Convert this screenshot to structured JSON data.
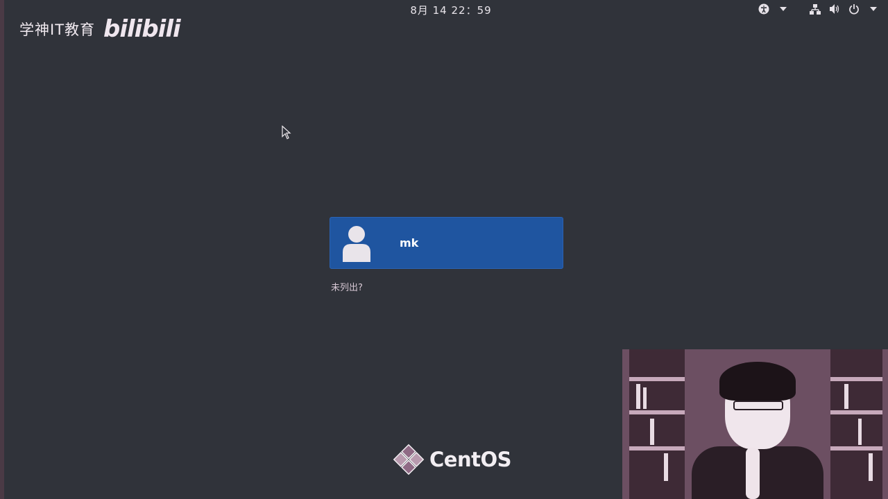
{
  "topbar": {
    "clock": "8月 14  22：59",
    "tray_icons": [
      "accessibility-icon",
      "chevron-down-icon",
      "network-icon",
      "volume-icon",
      "power-icon",
      "chevron-down-icon"
    ]
  },
  "watermark": {
    "brand": "学神IT教育",
    "bilibili": "bilibili"
  },
  "login": {
    "users": [
      {
        "name": "mk",
        "avatar_icon": "user-avatar-icon"
      }
    ],
    "not_listed_label": "未列出?"
  },
  "footer": {
    "logo_text": "CentOS",
    "logo_icon": "centos-logo-icon"
  },
  "colors": {
    "background": "#30333a",
    "selected_user": "#1f55a0",
    "text": "#ffffff"
  }
}
